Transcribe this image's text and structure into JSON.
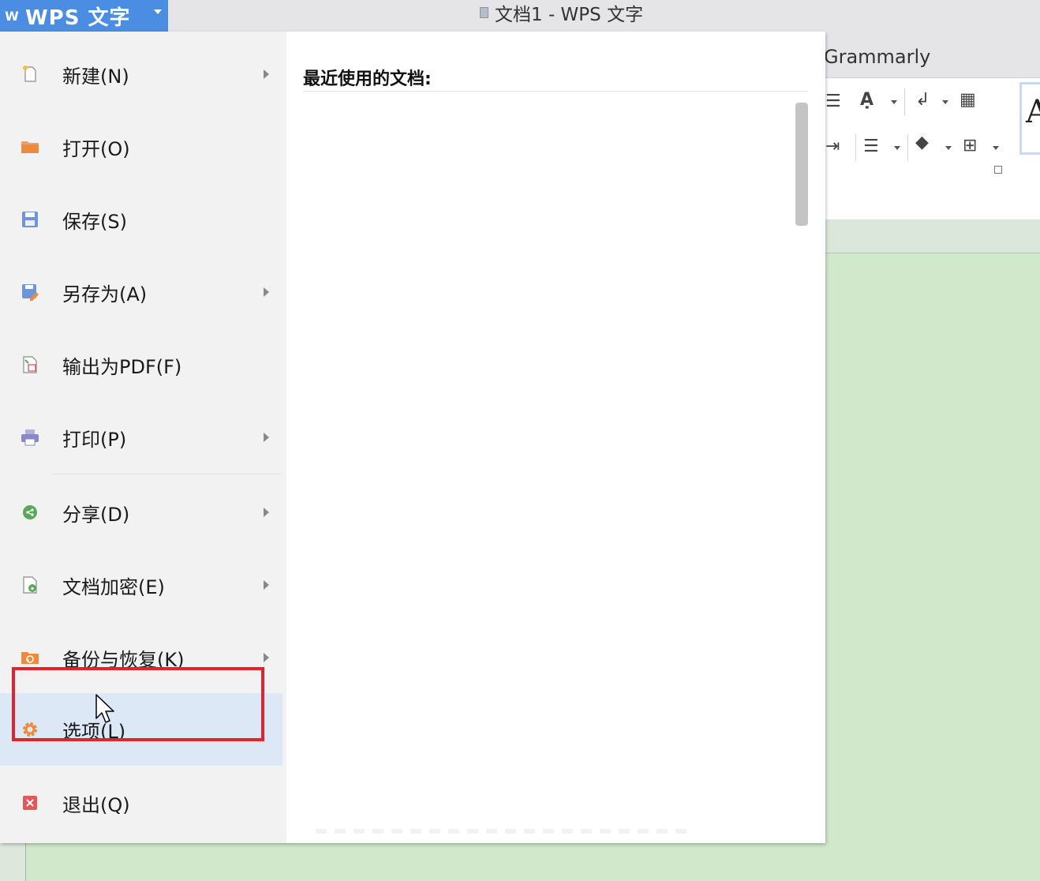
{
  "app": {
    "menu_button_logo": "W",
    "menu_button_label": "WPS 文字",
    "window_title": "文档1 - WPS 文字"
  },
  "ribbon": {
    "tab_label": "Grammarly",
    "style_preview": "A"
  },
  "file_menu": {
    "items": [
      {
        "label": "新建(N)",
        "icon": "new-document-icon",
        "submenu": true
      },
      {
        "label": "打开(O)",
        "icon": "open-folder-icon",
        "submenu": false
      },
      {
        "label": "保存(S)",
        "icon": "save-icon",
        "submenu": false
      },
      {
        "label": "另存为(A)",
        "icon": "save-as-icon",
        "submenu": true
      },
      {
        "label": "输出为PDF(F)",
        "icon": "export-pdf-icon",
        "submenu": false
      },
      {
        "label": "打印(P)",
        "icon": "printer-icon",
        "submenu": true
      },
      {
        "label": "分享(D)",
        "icon": "share-icon",
        "submenu": true
      },
      {
        "label": "文档加密(E)",
        "icon": "document-encrypt-icon",
        "submenu": true
      },
      {
        "label": "备份与恢复(K)",
        "icon": "backup-restore-icon",
        "submenu": true
      },
      {
        "label": "选项(L)",
        "icon": "gear-icon",
        "submenu": false,
        "selected": true
      },
      {
        "label": "退出(Q)",
        "icon": "exit-icon",
        "submenu": false
      }
    ]
  },
  "recent": {
    "title": "最近使用的文档:"
  },
  "colors": {
    "accent": "#4a8de2",
    "selected_row": "#dde8f7",
    "highlight_border": "#e0232f",
    "document_background": "#d1e8cb"
  }
}
